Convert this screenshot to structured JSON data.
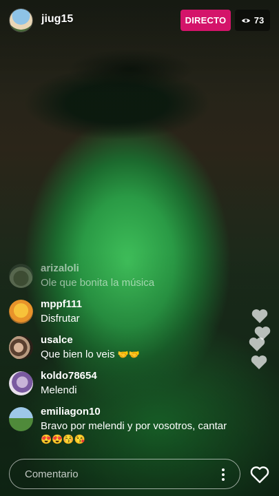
{
  "stream": {
    "username": "jiug15",
    "live_label": "DIRECTO",
    "viewer_count": "73",
    "live_color": "#d4146a"
  },
  "comments": [
    {
      "user": "arizaloli",
      "text": "Ole que bonita la música",
      "faded": true
    },
    {
      "user": "mppf111",
      "text": "Disfrutar"
    },
    {
      "user": "usalce",
      "text": "Que bien lo veis",
      "emoji": "🤝🤝"
    },
    {
      "user": "koldo78654",
      "text": "Melendi"
    },
    {
      "user": "emiliagon10",
      "text": "Bravo por melendi y por vosotros, cantar",
      "emoji": "😍😍😚😘"
    }
  ],
  "composer": {
    "placeholder": "Comentario",
    "more_icon": "more-vertical-icon",
    "like_icon": "heart-outline-icon"
  },
  "icons": {
    "viewer": "eye-icon",
    "floating": "heart-icon"
  }
}
